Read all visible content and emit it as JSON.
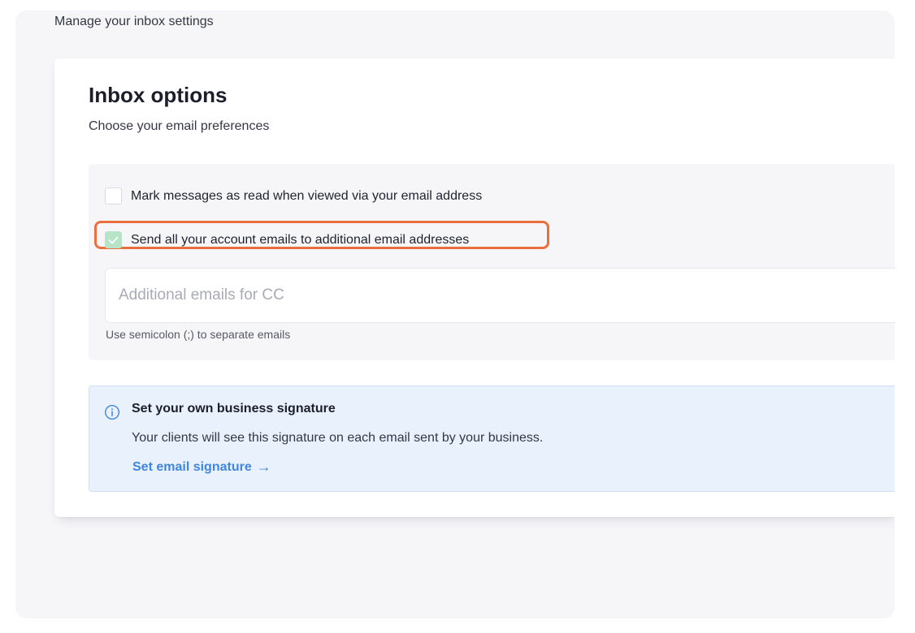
{
  "page": {
    "subtitle": "Manage your inbox settings"
  },
  "card": {
    "title": "Inbox options",
    "subtitle": "Choose your email preferences"
  },
  "options": [
    {
      "label": "Mark messages as read when viewed via your email address",
      "checked": false
    },
    {
      "label": "Send all your account emails to additional email addresses",
      "checked": true
    }
  ],
  "cc_input": {
    "placeholder": "Additional emails for CC",
    "value": "",
    "hint": "Use semicolon (;) to separate emails"
  },
  "signature": {
    "title": "Set your own business signature",
    "text": "Your clients will see this signature on each email sent by your business.",
    "link_label": "Set email signature",
    "link_arrow": "→"
  },
  "colors": {
    "highlight": "#e8703e",
    "checkbox_checked": "#b7e4c7",
    "link": "#3f86e0",
    "info_bg": "#e9f1fc"
  },
  "icons": {
    "checkbox_check": "checkmark-icon",
    "info": "info-circle-icon",
    "link_arrow": "arrow-right-icon"
  }
}
